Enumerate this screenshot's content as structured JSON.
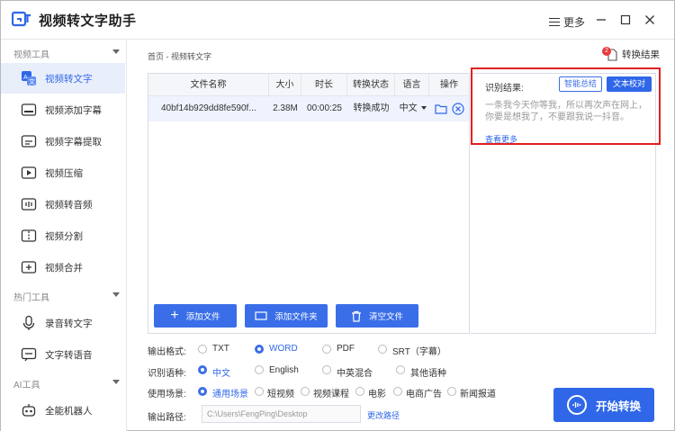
{
  "app": {
    "title": "视频转文字助手",
    "menu_label": "更多"
  },
  "sidebar": {
    "groups": [
      {
        "label": "视频工具",
        "items": [
          "视频转文字",
          "视频添加字幕",
          "视频字幕提取",
          "视频压缩",
          "视频转音频",
          "视频分割",
          "视频合并"
        ]
      },
      {
        "label": "热门工具",
        "items": [
          "录音转文字",
          "文字转语音"
        ]
      },
      {
        "label": "AI工具",
        "items": [
          "全能机器人"
        ]
      }
    ],
    "active_item": "视频转文字"
  },
  "breadcrumb": "首页 - 视频转文字",
  "result_link": {
    "label": "转换结果",
    "badge": "2"
  },
  "table": {
    "headers": [
      "文件名称",
      "大小",
      "时长",
      "转换状态",
      "语言",
      "操作"
    ],
    "row": {
      "name": "40bf14b929dd8fe590f...",
      "size": "2.38M",
      "duration": "00:00:25",
      "status": "转换成功",
      "language": "中文"
    }
  },
  "buttons": {
    "add_file": "添加文件",
    "add_folder": "添加文件夹",
    "clear_files": "清空文件"
  },
  "result": {
    "label": "识别结果:",
    "smart_summary": "智能总结",
    "text_proofread": "文本校对",
    "text": "一条我今天你等我，所以再次声在网上，你要是想我了，不要跟我说一抖音。",
    "view_more": "查看更多"
  },
  "options": {
    "output_format": {
      "label": "输出格式:",
      "choices": [
        "TXT",
        "WORD",
        "PDF",
        "SRT（字幕）"
      ],
      "selected": "WORD"
    },
    "language": {
      "label": "识别语种:",
      "choices": [
        "中文",
        "English",
        "中英混合",
        "其他语种"
      ],
      "selected": "中文"
    },
    "scene": {
      "label": "使用场景:",
      "choices": [
        "通用场景",
        "短视频",
        "视频课程",
        "电影",
        "电商广告",
        "新闻报道"
      ],
      "selected": "通用场景"
    },
    "output_path": {
      "label": "输出路径:",
      "value": "C:\\Users\\FengPing\\Desktop",
      "change_label": "更改路径"
    }
  },
  "start_button": "开始转换",
  "colors": {
    "accent": "#2f67e8",
    "highlight_box": "#e02020"
  }
}
